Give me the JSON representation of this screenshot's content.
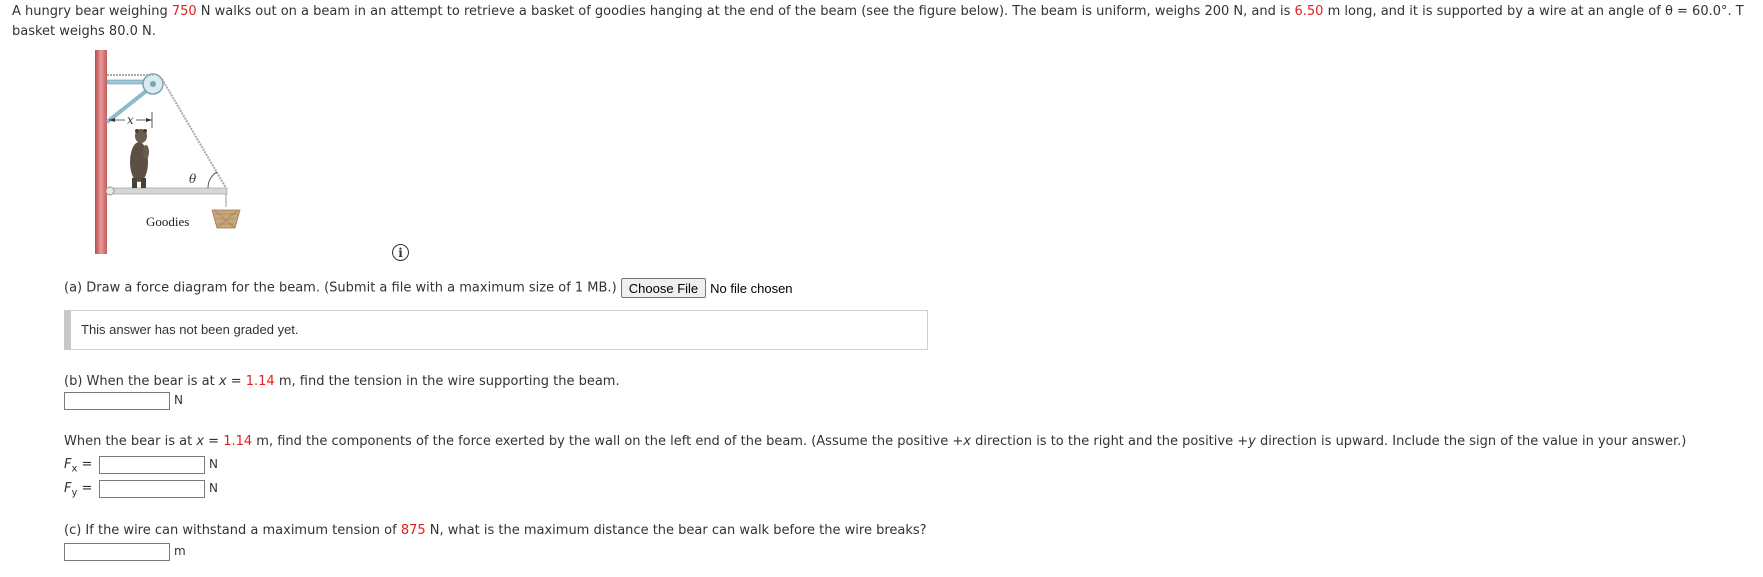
{
  "intro": {
    "p1": "A hungry bear weighing ",
    "bear_weight": "750",
    "p2": " N walks out on a beam in an attempt to retrieve a basket of goodies hanging at the end of the beam (see the figure below). The beam is uniform, weighs 200 N, and is ",
    "beam_length": "6.50",
    "p3": " m long, and it is supported by a wire at an angle of θ = 60.0°. T",
    "line2": "basket weighs 80.0 N."
  },
  "figure": {
    "x_label": "x",
    "theta_label": "θ",
    "goodies_label": "Goodies"
  },
  "info_icon": "i",
  "part_a": {
    "prompt": "(a) Draw a force diagram for the beam. (Submit a file with a maximum size of 1 MB.)",
    "choose_file": "Choose File",
    "no_file": "No file chosen",
    "graded_status": "This answer has not been graded yet."
  },
  "part_b": {
    "prompt_pre": "(b) When the bear is at ",
    "var": "x",
    "eq": " = ",
    "x_value": "1.14",
    "prompt_post": " m, find the tension in the wire supporting the beam.",
    "unit": "N"
  },
  "part_b2": {
    "prompt_pre": "When the bear is at ",
    "var": "x",
    "eq": " = ",
    "x_value": "1.14",
    "prompt_post": " m, find the components of the force exerted by the wall on the left end of the beam. (Assume the positive +",
    "var2": "x",
    "prompt_mid": " direction is to the right and the positive +",
    "var3": "y",
    "prompt_end": " direction is upward. Include the sign of the value in your answer.)",
    "fx_label": "F",
    "fx_sub": "x",
    "fy_label": "F",
    "fy_sub": "y",
    "equals": "=",
    "unit": "N"
  },
  "part_c": {
    "prompt_pre": "(c) If the wire can withstand a maximum tension of ",
    "max_tension": "875",
    "prompt_post": " N, what is the maximum distance the bear can walk before the wire breaks?",
    "unit": "m"
  }
}
